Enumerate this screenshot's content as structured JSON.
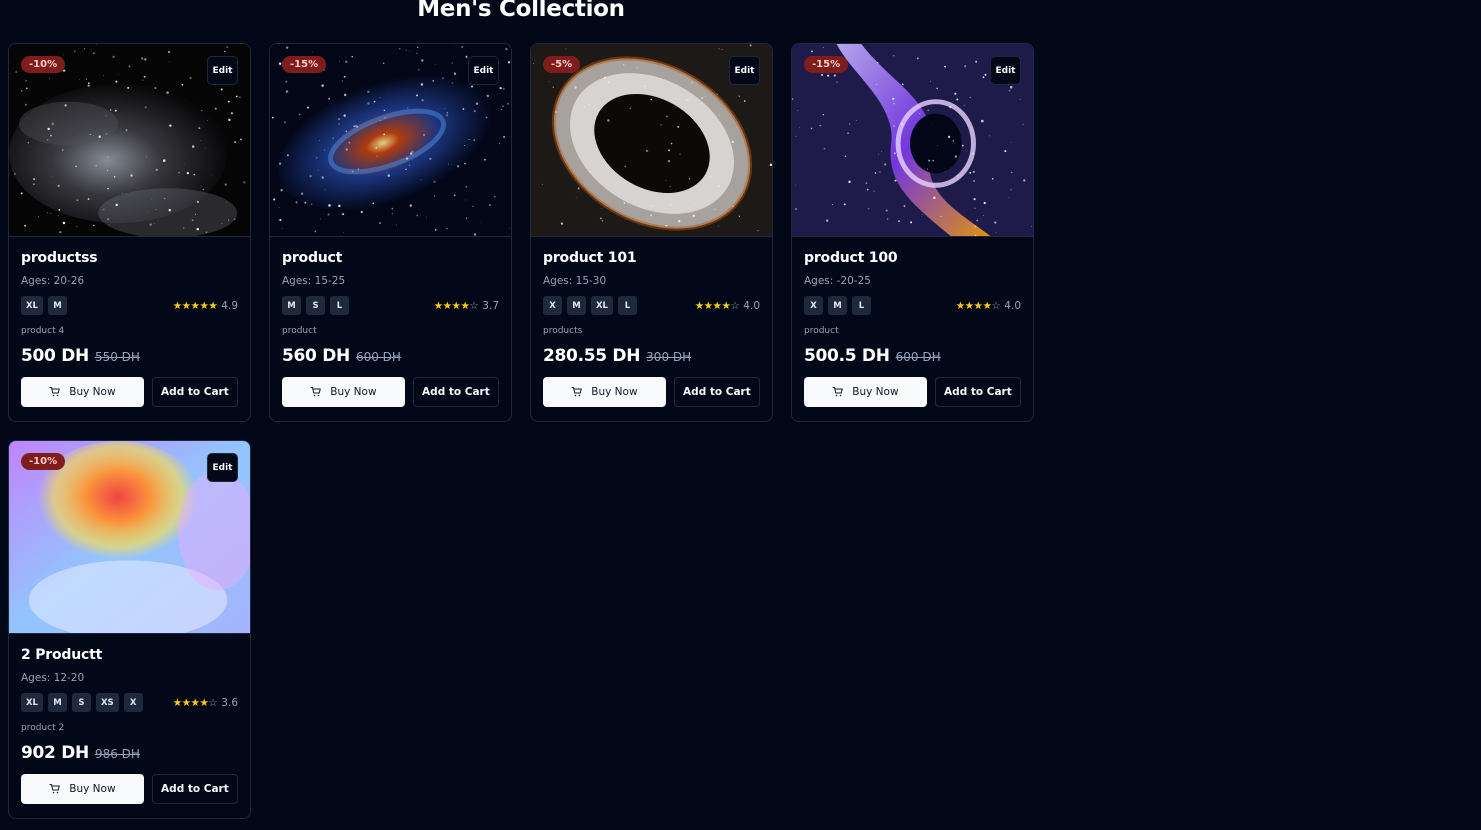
{
  "page": {
    "title": "Men's Collection"
  },
  "colors": {
    "background": "#020817",
    "discount_badge": "#7f1d1d",
    "star": "#facc15"
  },
  "products": [
    {
      "discount": "-10%",
      "edit_label": "Edit",
      "name": "productss",
      "ages": "Ages: 20-26",
      "sizes": [
        "XL",
        "M"
      ],
      "rating": 4.9,
      "rating_text": "4.9",
      "stars_full": 5,
      "description": "product 4",
      "price": "500 DH",
      "old_price": "550 DH",
      "buy_label": "Buy Now",
      "cart_label": "Add to Cart",
      "image": "grey-nebula"
    },
    {
      "discount": "-15%",
      "edit_label": "Edit",
      "name": "product",
      "ages": "Ages: 15-25",
      "sizes": [
        "M",
        "S",
        "L"
      ],
      "rating": 3.7,
      "rating_text": "3.7",
      "stars_full": 4,
      "description": "product",
      "price": "560 DH",
      "old_price": "600 DH",
      "buy_label": "Buy Now",
      "cart_label": "Add to Cart",
      "image": "spiral-galaxy"
    },
    {
      "discount": "-5%",
      "edit_label": "Edit",
      "name": "product 101",
      "ages": "Ages: 15-30",
      "sizes": [
        "X",
        "M",
        "XL",
        "L"
      ],
      "rating": 4.0,
      "rating_text": "4.0",
      "stars_full": 4,
      "description": "products",
      "price": "280.55 DH",
      "old_price": "300 DH",
      "buy_label": "Buy Now",
      "cart_label": "Add to Cart",
      "image": "galaxy-ring"
    },
    {
      "discount": "-15%",
      "edit_label": "Edit",
      "name": "product 100",
      "ages": "Ages: -20-25",
      "sizes": [
        "X",
        "M",
        "L"
      ],
      "rating": 4.0,
      "rating_text": "4.0",
      "stars_full": 4,
      "description": "product",
      "price": "500.5 DH",
      "old_price": "600 DH",
      "buy_label": "Buy Now",
      "cart_label": "Add to Cart",
      "image": "black-hole"
    },
    {
      "discount": "-10%",
      "edit_label": "Edit",
      "name": "2 Productt",
      "ages": "Ages: 12-20",
      "sizes": [
        "XL",
        "M",
        "S",
        "XS",
        "X"
      ],
      "rating": 3.6,
      "rating_text": "3.6",
      "stars_full": 4,
      "description": "product 2",
      "price": "902 DH",
      "old_price": "986 DH",
      "buy_label": "Buy Now",
      "cart_label": "Add to Cart",
      "image": "pastel-abstract"
    }
  ]
}
